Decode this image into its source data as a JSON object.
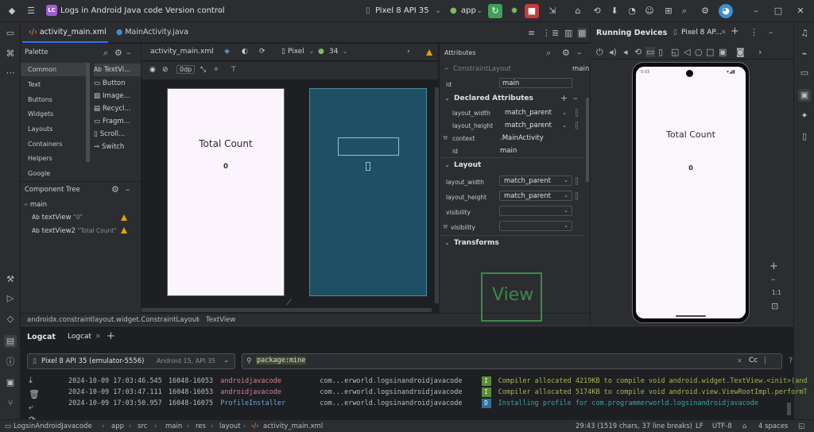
{
  "titlebar": {
    "logo": "LC",
    "project": "Logs in Android Java code",
    "vcs": "Version control",
    "device": "Pixel 8 API 35",
    "run_config": "app"
  },
  "editor_tabs": [
    {
      "label": "activity_main.xml"
    },
    {
      "label": "MainActivity.java"
    }
  ],
  "palette": {
    "title": "Palette",
    "categories": [
      "Common",
      "Text",
      "Buttons",
      "Widgets",
      "Layouts",
      "Containers",
      "Helpers",
      "Google"
    ],
    "items": [
      "TextVi...",
      "Button",
      "Image...",
      "Recycl...",
      "Fragm...",
      "Scroll...",
      "Switch"
    ]
  },
  "component_tree": {
    "title": "Component Tree",
    "root": "main",
    "children": [
      {
        "name": "textView",
        "text": "\"0\""
      },
      {
        "name": "textView2",
        "text": "\"Total Count\""
      }
    ]
  },
  "design_toolbar": {
    "file": "activity_main.xml",
    "device": "Pixel",
    "api": "34",
    "margin": "0dp"
  },
  "preview": {
    "title_text": "Total Count",
    "count_text": "0"
  },
  "breadcrumb": [
    "androidx.constraintlayout.widget.ConstraintLayout",
    "TextView"
  ],
  "attributes": {
    "title": "Attributes",
    "class_name": "ConstraintLayout",
    "id_label": "id",
    "id_value": "main",
    "header_id": "main",
    "declared_title": "Declared Attributes",
    "declared": [
      {
        "name": "layout_width",
        "value": "match_parent"
      },
      {
        "name": "layout_height",
        "value": "match_parent"
      },
      {
        "name": "context",
        "value": ".MainActivity"
      },
      {
        "name": "id",
        "value": "main"
      }
    ],
    "layout_title": "Layout",
    "layout": [
      {
        "name": "layout_width",
        "value": "match_parent"
      },
      {
        "name": "layout_height",
        "value": "match_parent"
      },
      {
        "name": "visibility",
        "value": ""
      },
      {
        "name": "visibility",
        "value": ""
      }
    ],
    "transforms_title": "Transforms",
    "view_preview": "View"
  },
  "running_devices": {
    "title": "Running Devices",
    "tab": "Pixel 8 AP...",
    "phone_time": "5:03",
    "screen_title": "Total Count",
    "screen_count": "0",
    "zoom_ratio": "1:1"
  },
  "logcat": {
    "tabs": [
      "Logcat",
      "Logcat"
    ],
    "device_select": "Pixel 8 API 35 (emulator-5556)",
    "device_detail": "Android 15, API 35",
    "filter": "package:mine",
    "filter_case": "Cc",
    "lines": [
      {
        "time": "2024-10-09 17:03:46.545",
        "pid": "16048-16053",
        "tag": "androidjavacode",
        "pkg": "com...erworld.logsinandroidjavacode",
        "level": "I",
        "msg": "Compiler allocated 4219KB to compile void android.widget.TextView.<init>(and"
      },
      {
        "time": "2024-10-09 17:03:47.111",
        "pid": "16048-16053",
        "tag": "androidjavacode",
        "pkg": "com...erworld.logsinandroidjavacode",
        "level": "I",
        "msg": "Compiler allocated 5174KB to compile void android.view.ViewRootImpl.performT"
      },
      {
        "time": "2024-10-09 17:03:50.957",
        "pid": "16048-16075",
        "tag": "ProfileInstaller",
        "pkg": "com...erworld.logsinandroidjavacode",
        "level": "D",
        "msg": "Installing profile for com.programmerworld.logsinandroidjavacode"
      }
    ]
  },
  "statusbar": {
    "path": [
      "LogsinAndroidJavacode",
      "app",
      "src",
      "main",
      "res",
      "layout",
      "activity_main.xml"
    ],
    "position": "29:43 (1519 chars, 37 line breaks)",
    "line_sep": "LF",
    "encoding": "UTF-8",
    "indent": "4 spaces"
  },
  "colors": {
    "accent": "#3574f0",
    "warning": "#e5a200",
    "log_info": "#5b8c3a",
    "log_debug": "#2f6f9f",
    "run_green": "#3fa05a",
    "stop_red": "#c9393b"
  }
}
